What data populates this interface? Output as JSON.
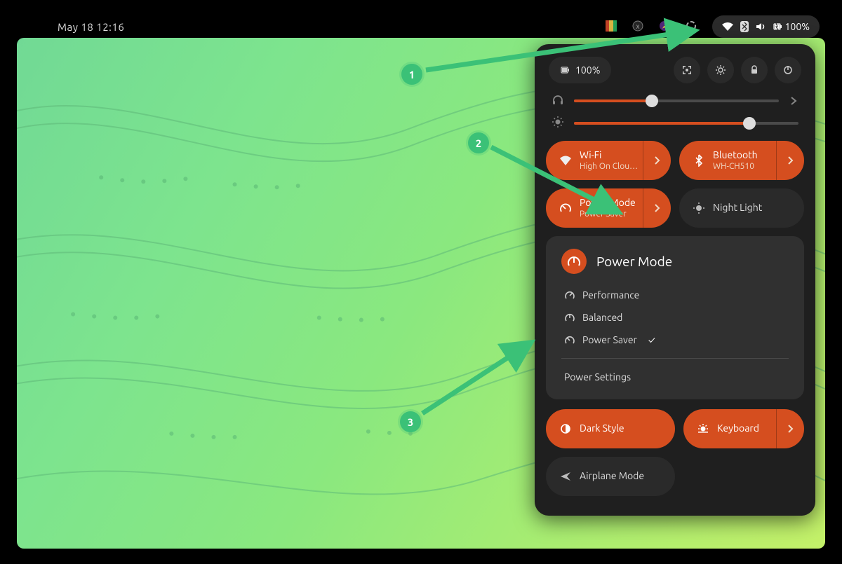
{
  "topbar": {
    "datetime": "May 18  12:16",
    "battery_text": "100%"
  },
  "qs": {
    "battery_chip": "100%",
    "volume": 38,
    "brightness": 78,
    "tiles": {
      "wifi": {
        "label": "Wi-Fi",
        "sub": "High On Clou…"
      },
      "bluetooth": {
        "label": "Bluetooth",
        "sub": "WH-CH510"
      },
      "power": {
        "label": "Power Mode",
        "sub": "Power Saver"
      },
      "night": {
        "label": "Night Light"
      },
      "dark": {
        "label": "Dark Style"
      },
      "keyboard": {
        "label": "Keyboard"
      },
      "airplane": {
        "label": "Airplane Mode"
      }
    },
    "submenu": {
      "title": "Power Mode",
      "options": [
        "Performance",
        "Balanced",
        "Power Saver"
      ],
      "selected": "Power Saver",
      "footer": "Power Settings"
    }
  },
  "annotations": {
    "a1": "1",
    "a2": "2",
    "a3": "3"
  }
}
